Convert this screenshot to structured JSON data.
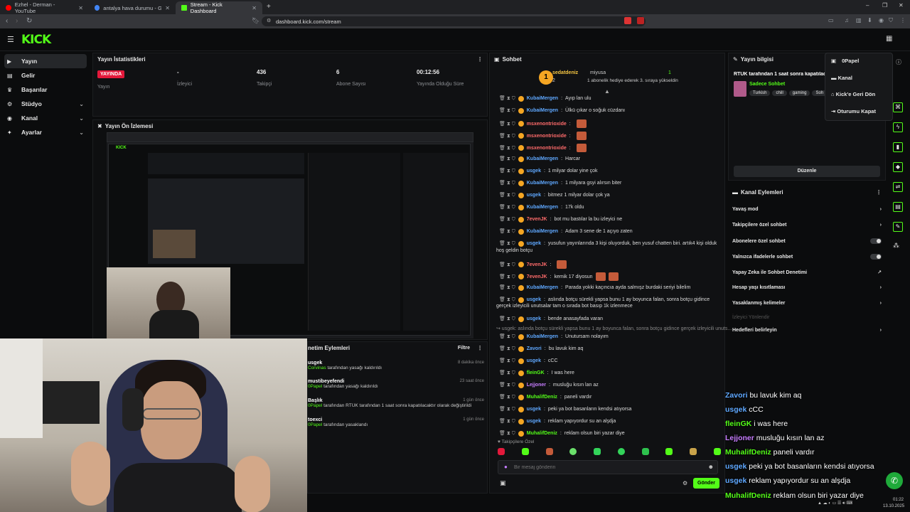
{
  "browser": {
    "tabs": [
      {
        "title": "Ezhel - Derman - YouTube",
        "color": "#ff0000"
      },
      {
        "title": "antalya hava durumu - Google Search",
        "color": "#4285f4"
      },
      {
        "title": "Stream - Kick Dashboard",
        "color": "#53fc18"
      }
    ],
    "url": "dashboard.kick.com/stream"
  },
  "brand": {
    "logo": "KICK",
    "accent": "#53fc18"
  },
  "sidebar": {
    "items": [
      {
        "label": "Yayın",
        "icon": "broadcast-icon"
      },
      {
        "label": "Gelir",
        "icon": "revenue-icon"
      },
      {
        "label": "Başarılar",
        "icon": "trophy-icon"
      },
      {
        "label": "Stüdyo",
        "icon": "studio-icon"
      },
      {
        "label": "Kanal",
        "icon": "channel-icon"
      },
      {
        "label": "Ayarlar",
        "icon": "settings-icon"
      }
    ]
  },
  "stats": {
    "title": "Yayın İstatistikleri",
    "live_badge": "YAYINDA",
    "items": [
      {
        "value": "",
        "label": "Yayın"
      },
      {
        "value": "-",
        "label": "İzleyici"
      },
      {
        "value": "436",
        "label": "Takipçi"
      },
      {
        "value": "6",
        "label": "Abone Sayısı"
      },
      {
        "value": "00:12:56",
        "label": "Yayında Olduğu Süre"
      }
    ]
  },
  "preview": {
    "title": "Yayın Ön İzlemesi"
  },
  "mod_actions": {
    "title": "netim Eylemleri",
    "filter": "Filtre",
    "items": [
      {
        "name": "usgek",
        "actor": "Corvinas",
        "text": "tarafından yasağı kaldırıldı",
        "time": "8 dakika önce"
      },
      {
        "name": "mustibeyefendi",
        "actor": "0Papel",
        "text": "tarafından yasağı kaldırıldı",
        "time": "23 saat önce"
      },
      {
        "name": "Başlık",
        "actor": "0Papel",
        "text": "tarafından RTÜK tarafından 1 saat sonra kapatılacaktır olarak değiştirildi",
        "time": "1 gün önce"
      },
      {
        "name": "toexci",
        "actor": "0Papel",
        "text": "tarafından yasaklandı",
        "time": "1 gün önce"
      }
    ]
  },
  "chat": {
    "title": "Sohbet",
    "top_user": "sedatdeniz",
    "top_sub": "miyusa",
    "top_count": "1",
    "top_count2": "2",
    "top_text": "1 abonelik hediye ederek 3. sıraya yükseldin",
    "messages": [
      {
        "user": "KubaiMergen",
        "color": "#5fa8ff",
        "text": "Ayıp lan ulu"
      },
      {
        "user": "KubaiMergen",
        "color": "#5fa8ff",
        "text": "Ülkü çıkar o soğuk cüzdanı"
      },
      {
        "user": "msxenontrioxide",
        "color": "#ff6b6b",
        "text": "",
        "emote": true
      },
      {
        "user": "msxenontrioxide",
        "color": "#ff6b6b",
        "text": "",
        "emote": true
      },
      {
        "user": "msxenontrioxide",
        "color": "#ff6b6b",
        "text": "",
        "emote": true
      },
      {
        "user": "KubaiMergen",
        "color": "#5fa8ff",
        "text": "Harcar"
      },
      {
        "user": "usgek",
        "color": "#5fa8ff",
        "text": "1 milyar dolar yine çok"
      },
      {
        "user": "KubaiMergen",
        "color": "#5fa8ff",
        "text": "1 milyara gsyi alırsın biter"
      },
      {
        "user": "usgek",
        "color": "#5fa8ff",
        "text": "bitmez 1 milyar dolar çok ya"
      },
      {
        "user": "KubaiMergen",
        "color": "#5fa8ff",
        "text": "17k oldu"
      },
      {
        "user": "7evenJK",
        "color": "#ff6b6b",
        "text": "bot mu bastılar la bu izleyici ne"
      },
      {
        "user": "KubaiMergen",
        "color": "#5fa8ff",
        "text": "Adam 3 sene de 1 açıyo zaten"
      },
      {
        "user": "usgek",
        "color": "#5fa8ff",
        "text": "yusufun yayınlarında 3 kişi oluyorduk, ben yusuf chatten biri. artık4 kişi olduk"
      },
      {
        "user": "",
        "color": "#ddd",
        "text": "hoş geldin botçu"
      },
      {
        "user": "7evenJK",
        "color": "#ff6b6b",
        "text": "",
        "emote": true
      },
      {
        "user": "7evenJK",
        "color": "#ff6b6b",
        "text": "kemik 17 diyosun",
        "emote": true
      },
      {
        "user": "KubaiMergen",
        "color": "#5fa8ff",
        "text": "Parada yokki kaçıncıa ayda salmışz burdaki seriyi bilelim"
      },
      {
        "user": "usgek",
        "color": "#5fa8ff",
        "text": "aslında botçu sürekli yapsa bunu 1 ay boyunca falan, sonra botçu gidince"
      },
      {
        "user": "",
        "color": "#ddd",
        "text": "gerçek izleyicili unutsalar tam o sırada bot basıp 1k izlenmece"
      },
      {
        "user": "usgek",
        "color": "#5fa8ff",
        "text": "bende anasayfada varan"
      },
      {
        "user": "",
        "color": "#888",
        "text": "↪ usgek: aslında botçu sürekli yapsa bunu 1 ay boyunca falan, sonra botçu gidince gerçek izleyicili unuts..."
      },
      {
        "user": "KubaiMergen",
        "color": "#5fa8ff",
        "text": "Unutursam nolayım"
      },
      {
        "user": "Zavori",
        "color": "#5fa8ff",
        "text": "bu lavuk kim aq"
      },
      {
        "user": "usgek",
        "color": "#5fa8ff",
        "text": "cCC"
      },
      {
        "user": "fleinGK",
        "color": "#53fc18",
        "text": "I was here"
      },
      {
        "user": "Lejjoner",
        "color": "#c77dff",
        "text": "musluğu kısın lan az"
      },
      {
        "user": "MuhalifDeniz",
        "color": "#53fc18",
        "text": "paneli vardır"
      },
      {
        "user": "usgek",
        "color": "#5fa8ff",
        "text": "peki ya bot basanların kendsi atıyorsa"
      },
      {
        "user": "usgek",
        "color": "#5fa8ff",
        "text": "reklam yapıyordur su an alşdja"
      },
      {
        "user": "MuhalifDeniz",
        "color": "#53fc18",
        "text": "reklam olsun biri yazar diye"
      }
    ],
    "followers_label": "Takipçilere Özel",
    "input_placeholder": "Bir mesaj gönderin",
    "send_label": "Gönder"
  },
  "stream_info": {
    "title": "Yayın bilgisi",
    "stream_title": "RTÜK tarafından 1 saat sonra kapatılac",
    "category": "Sadece Sohbet",
    "tags": [
      "Turkish",
      "chill",
      "gaming",
      "Soh"
    ],
    "edit_label": "Düzenle"
  },
  "user_menu": {
    "username": "0Papel",
    "items": [
      "Kanal",
      "Kick'e Geri Dön",
      "Oturumu Kapat"
    ]
  },
  "channel_actions": {
    "title": "Kanal Eylemleri",
    "items": [
      {
        "label": "Yavaş mod",
        "control": "chevron"
      },
      {
        "label": "Takipçilere özel sohbet",
        "control": "chevron"
      },
      {
        "label": "Abonelere özel sohbet",
        "control": "toggle"
      },
      {
        "label": "Yalnızca ifadelerle sohbet",
        "control": "toggle"
      },
      {
        "label": "Yapay Zeka ile Sohbet Denetimi",
        "control": "link"
      },
      {
        "label": "Hesap yaşı kısıtlaması",
        "control": "chevron"
      },
      {
        "label": "Yasaklanmış kelimeler",
        "control": "chevron"
      },
      {
        "label": "İzleyici Yönlendir",
        "control": "none"
      },
      {
        "label": "Hedefleri belirleyin",
        "control": "chevron"
      }
    ]
  },
  "overlay_chat": [
    {
      "user": "Zavori",
      "color": "#5fa8ff",
      "text": "bu lavuk kim aq"
    },
    {
      "user": "usgek",
      "color": "#5fa8ff",
      "text": "cCC"
    },
    {
      "user": "fleinGK",
      "color": "#53fc18",
      "text": "i was here"
    },
    {
      "user": "Lejjoner",
      "color": "#c77dff",
      "text": "musluğu kısın lan az"
    },
    {
      "user": "MuhalifDeniz",
      "color": "#53fc18",
      "text": "paneli vardır"
    },
    {
      "user": "usgek",
      "color": "#5fa8ff",
      "text": "peki ya bot basanların kendsi atıyorsa"
    },
    {
      "user": "usgek",
      "color": "#5fa8ff",
      "text": "reklam yapıyordur su an alşdja"
    },
    {
      "user": "MuhalifDeniz",
      "color": "#53fc18",
      "text": "reklam olsun biri yazar diye"
    }
  ],
  "taskbar": {
    "time": "01:22",
    "date": "13.10.2025"
  }
}
